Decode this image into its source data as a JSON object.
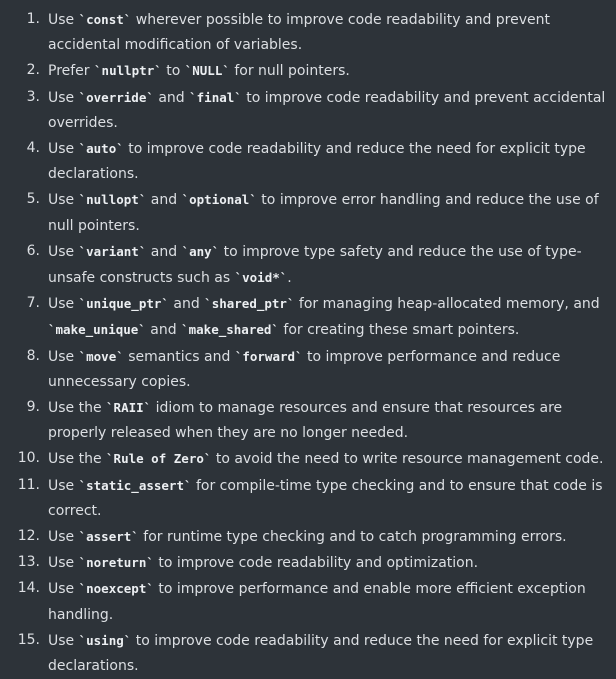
{
  "items": [
    {
      "num": "1.",
      "parts": [
        {
          "t": "Use "
        },
        {
          "c": "`const`"
        },
        {
          "t": " wherever possible to improve code readability and prevent accidental modification of variables."
        }
      ]
    },
    {
      "num": "2.",
      "parts": [
        {
          "t": "Prefer "
        },
        {
          "c": "`nullptr`"
        },
        {
          "t": " to "
        },
        {
          "c": "`NULL`"
        },
        {
          "t": " for null pointers."
        }
      ]
    },
    {
      "num": "3.",
      "parts": [
        {
          "t": "Use "
        },
        {
          "c": "`override`"
        },
        {
          "t": " and "
        },
        {
          "c": "`final`"
        },
        {
          "t": " to improve code readability and prevent accidental overrides."
        }
      ]
    },
    {
      "num": "4.",
      "parts": [
        {
          "t": "Use "
        },
        {
          "c": "`auto`"
        },
        {
          "t": " to improve code readability and reduce the need for explicit type declarations."
        }
      ]
    },
    {
      "num": "5.",
      "parts": [
        {
          "t": "Use "
        },
        {
          "c": "`nullopt`"
        },
        {
          "t": " and "
        },
        {
          "c": "`optional`"
        },
        {
          "t": " to improve error handling and reduce the use of null pointers."
        }
      ]
    },
    {
      "num": "6.",
      "parts": [
        {
          "t": "Use "
        },
        {
          "c": "`variant`"
        },
        {
          "t": " and "
        },
        {
          "c": "`any`"
        },
        {
          "t": " to improve type safety and reduce the use of type-unsafe constructs such as "
        },
        {
          "c": "`void*`"
        },
        {
          "t": "."
        }
      ]
    },
    {
      "num": "7.",
      "parts": [
        {
          "t": "Use "
        },
        {
          "c": "`unique_ptr`"
        },
        {
          "t": " and "
        },
        {
          "c": "`shared_ptr`"
        },
        {
          "t": " for managing heap-allocated memory, and "
        },
        {
          "c": "`make_unique`"
        },
        {
          "t": " and "
        },
        {
          "c": "`make_shared`"
        },
        {
          "t": " for creating these smart pointers."
        }
      ]
    },
    {
      "num": "8.",
      "parts": [
        {
          "t": "Use "
        },
        {
          "c": "`move`"
        },
        {
          "t": " semantics and "
        },
        {
          "c": "`forward`"
        },
        {
          "t": " to improve performance and reduce unnecessary copies."
        }
      ]
    },
    {
      "num": "9.",
      "parts": [
        {
          "t": "Use the "
        },
        {
          "c": "`RAII`"
        },
        {
          "t": " idiom to manage resources and ensure that resources are properly released when they are no longer needed."
        }
      ]
    },
    {
      "num": "10.",
      "parts": [
        {
          "t": "Use the "
        },
        {
          "c": "`Rule of Zero`"
        },
        {
          "t": " to avoid the need to write resource management code."
        }
      ]
    },
    {
      "num": "11.",
      "parts": [
        {
          "t": "Use "
        },
        {
          "c": "`static_assert`"
        },
        {
          "t": " for compile-time type checking and to ensure that code is correct."
        }
      ]
    },
    {
      "num": "12.",
      "parts": [
        {
          "t": "Use "
        },
        {
          "c": "`assert`"
        },
        {
          "t": " for runtime type checking and to catch programming errors."
        }
      ]
    },
    {
      "num": "13.",
      "parts": [
        {
          "t": "Use "
        },
        {
          "c": "`noreturn`"
        },
        {
          "t": " to improve code readability and optimization."
        }
      ]
    },
    {
      "num": "14.",
      "parts": [
        {
          "t": "Use "
        },
        {
          "c": "`noexcept`"
        },
        {
          "t": " to improve performance and enable more efficient exception handling."
        }
      ]
    },
    {
      "num": "15.",
      "parts": [
        {
          "t": "Use "
        },
        {
          "c": "`using`"
        },
        {
          "t": " to improve code readability and reduce the need for explicit type declarations."
        }
      ]
    }
  ]
}
